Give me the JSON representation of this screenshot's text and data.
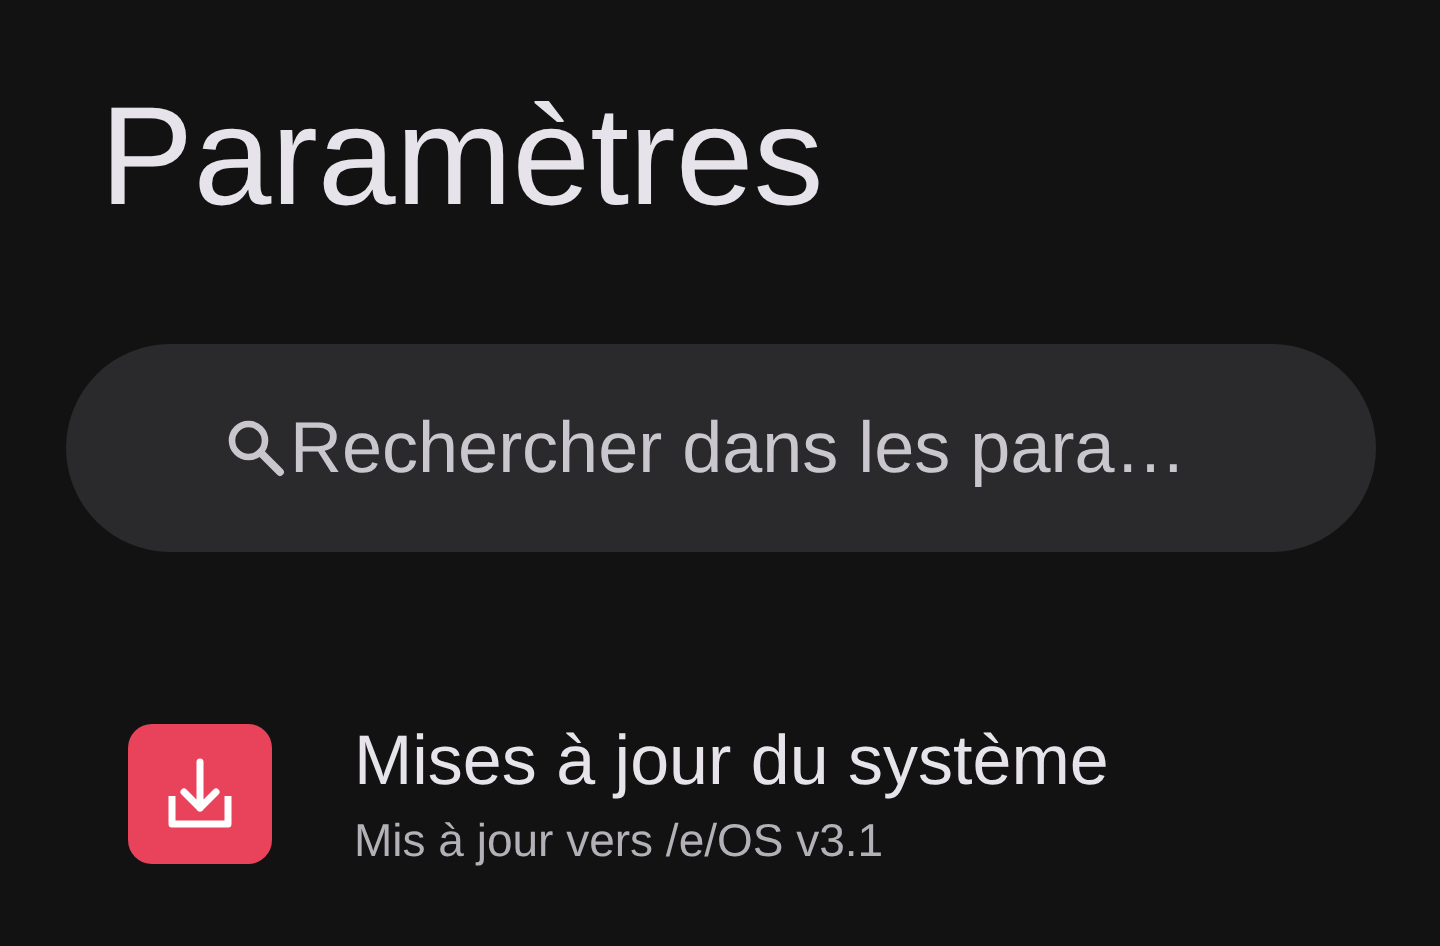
{
  "title": "Paramètres",
  "search": {
    "placeholder": "Rechercher dans les para…"
  },
  "items": [
    {
      "kind": "update",
      "title": "Mises à jour du système",
      "subtitle": "Mis à jour vers /e/OS v3.1",
      "color": "#e8435a"
    }
  ]
}
